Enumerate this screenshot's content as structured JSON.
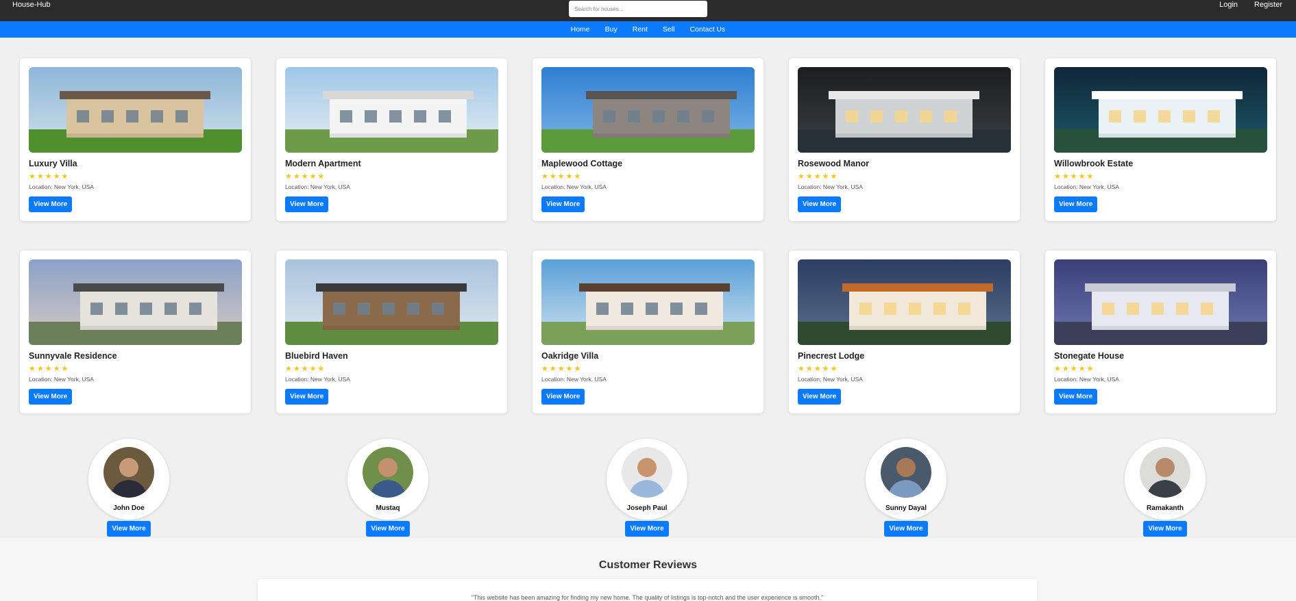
{
  "header": {
    "brand": "House-Hub",
    "search_placeholder": "Search for houses...",
    "login_label": "Login",
    "register_label": "Register"
  },
  "nav": {
    "items": [
      "Home",
      "Buy",
      "Rent",
      "Sell",
      "Contact Us"
    ]
  },
  "listings": [
    {
      "title": "Luxury Villa",
      "location": "Location: New York, USA",
      "button": "View More",
      "rating": 5
    },
    {
      "title": "Modern Apartment",
      "location": "Location: New York, USA",
      "button": "View More",
      "rating": 5
    },
    {
      "title": "Maplewood Cottage",
      "location": "Location: New York, USA",
      "button": "View More",
      "rating": 5
    },
    {
      "title": "Rosewood Manor",
      "location": "Location: New York, USA",
      "button": "View More",
      "rating": 5
    },
    {
      "title": "Willowbrook Estate",
      "location": "Location: New York, USA",
      "button": "View More",
      "rating": 5
    },
    {
      "title": "Sunnyvale Residence",
      "location": "Location: New York, USA",
      "button": "View More",
      "rating": 5
    },
    {
      "title": "Bluebird Haven",
      "location": "Location: New York, USA",
      "button": "View More",
      "rating": 5
    },
    {
      "title": "Oakridge Villa",
      "location": "Location: New York, USA",
      "button": "View More",
      "rating": 5
    },
    {
      "title": "Pinecrest Lodge",
      "location": "Location: New York, USA",
      "button": "View More",
      "rating": 5
    },
    {
      "title": "Stonegate House",
      "location": "Location: New York, USA",
      "button": "View More",
      "rating": 5
    }
  ],
  "agents": [
    {
      "name": "John Doe",
      "button": "View More"
    },
    {
      "name": "Mustaq",
      "button": "View More"
    },
    {
      "name": "Joseph Paul",
      "button": "View More"
    },
    {
      "name": "Sunny Dayal",
      "button": "View More"
    },
    {
      "name": "Ramakanth",
      "button": "View More"
    }
  ],
  "reviews": {
    "title": "Customer Reviews",
    "items": [
      "\"This website has been amazing for finding my new home. The quality of listings is top-notch and the user experience is smooth.\""
    ]
  },
  "colors": {
    "topbar": "#2b2b2b",
    "accent": "#0a7bff",
    "star": "#f5c518",
    "background": "#f0f0f0"
  },
  "icons": {
    "rating": "star-icon"
  }
}
